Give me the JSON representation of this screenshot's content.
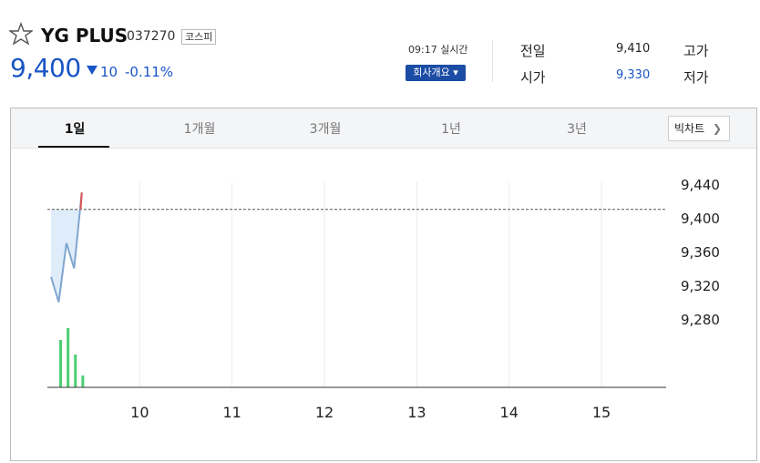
{
  "stock": {
    "name": "YG PLUS",
    "code": "037270",
    "market": "코스피",
    "price": "9,400",
    "change": "10",
    "change_pct": "-0.11%",
    "direction": "down",
    "time_label": "09:17 실시간",
    "company_button": "회사개요 ▾"
  },
  "quotes": [
    {
      "label": "전일",
      "value": "9,410"
    },
    {
      "label": "고가",
      "value": ""
    },
    {
      "label": "시가",
      "value": "9,330"
    },
    {
      "label": "저가",
      "value": ""
    }
  ],
  "tabs": [
    "1일",
    "1개월",
    "3개월",
    "1년",
    "3년"
  ],
  "active_tab": "1일",
  "chart_type_button": "빅차트",
  "colors": {
    "price_blue": "#1a55c7",
    "line": "#7fa6cf",
    "fill": "#dceaf8",
    "up_segment": "#d9534f",
    "volume": "#4cce72"
  },
  "chart_data": {
    "type": "line",
    "y_ticks": [
      "9,440",
      "9,400",
      "9,360",
      "9,320",
      "9,280"
    ],
    "x_ticks": [
      "10",
      "11",
      "12",
      "13",
      "14",
      "15"
    ],
    "ylim": [
      9240,
      9450
    ],
    "reference_line": 9410,
    "series": [
      {
        "x": [
          9.0,
          9.083,
          9.167,
          9.25,
          9.333
        ],
        "values": [
          9330,
          9300,
          9370,
          9340,
          9430
        ]
      }
    ],
    "volume": {
      "x": [
        9.03,
        9.11,
        9.19,
        9.27
      ],
      "values": [
        52,
        65,
        36,
        13
      ]
    },
    "grid": true
  }
}
